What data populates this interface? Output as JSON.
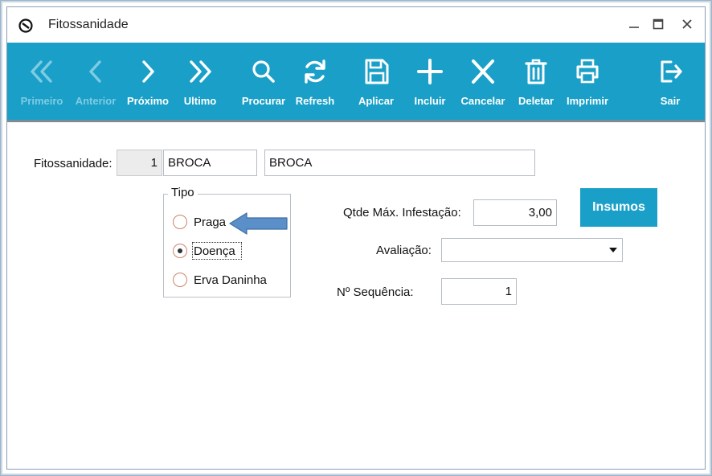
{
  "window": {
    "title": "Fitossanidade"
  },
  "toolbar": {
    "buttons": [
      {
        "label": "Primeiro",
        "icon": "double-chevron-left-icon",
        "enabled": false
      },
      {
        "label": "Anterior",
        "icon": "chevron-left-icon",
        "enabled": false
      },
      {
        "label": "Próximo",
        "icon": "chevron-right-icon",
        "enabled": true
      },
      {
        "label": "Ultimo",
        "icon": "double-chevron-right-icon",
        "enabled": true
      },
      {
        "label": "Procurar",
        "icon": "search-icon",
        "enabled": true
      },
      {
        "label": "Refresh",
        "icon": "refresh-icon",
        "enabled": true
      },
      {
        "label": "Aplicar",
        "icon": "save-icon",
        "enabled": true
      },
      {
        "label": "Incluir",
        "icon": "plus-icon",
        "enabled": true
      },
      {
        "label": "Cancelar",
        "icon": "close-icon",
        "enabled": true
      },
      {
        "label": "Deletar",
        "icon": "trash-icon",
        "enabled": true
      },
      {
        "label": "Imprimir",
        "icon": "printer-icon",
        "enabled": true
      },
      {
        "label": "Sair",
        "icon": "exit-icon",
        "enabled": true
      }
    ],
    "accent_color": "#1aa0c8"
  },
  "form": {
    "fitossanidade_label": "Fitossanidade:",
    "code_value": "1",
    "short_name_value": "BROCA",
    "description_value": "BROCA",
    "tipo": {
      "title": "Tipo",
      "options": [
        {
          "label": "Praga",
          "selected": false
        },
        {
          "label": "Doença",
          "selected": true
        },
        {
          "label": "Erva Daninha",
          "selected": false
        }
      ]
    },
    "qtde_label": "Qtde Máx. Infestação:",
    "qtde_value": "3,00",
    "insumos_label": "Insumos",
    "avaliacao_label": "Avaliação:",
    "avaliacao_value": "",
    "sequencia_label": "Nº Sequência:",
    "sequencia_value": "1"
  }
}
